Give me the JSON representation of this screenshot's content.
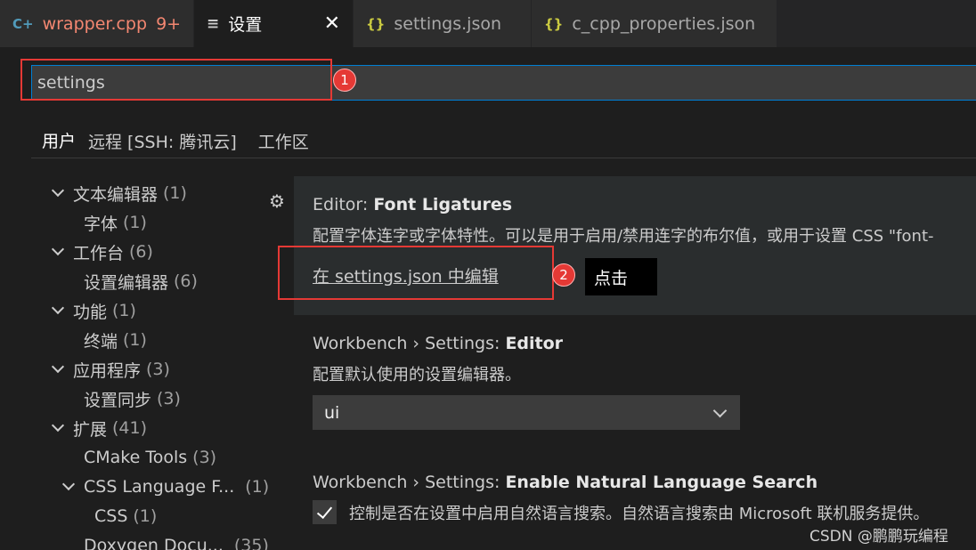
{
  "tabs": [
    {
      "icon": "C+",
      "label": "wrapper.cpp",
      "badge": "9+"
    },
    {
      "icon": "≡",
      "label": "设置",
      "close": "✕"
    },
    {
      "icon": "{}",
      "label": "settings.json"
    },
    {
      "icon": "{}",
      "label": "c_cpp_properties.json"
    }
  ],
  "search": {
    "value": "settings",
    "callout": "1"
  },
  "scopes": [
    "用户",
    "远程 [SSH: 腾讯云]",
    "工作区"
  ],
  "tree": [
    {
      "label": "文本编辑器",
      "count": "(1)"
    },
    {
      "label": "字体",
      "count": "(1)"
    },
    {
      "label": "工作台",
      "count": "(6)"
    },
    {
      "label": "设置编辑器",
      "count": "(6)"
    },
    {
      "label": "功能",
      "count": "(1)"
    },
    {
      "label": "终端",
      "count": "(1)"
    },
    {
      "label": "应用程序",
      "count": "(3)"
    },
    {
      "label": "设置同步",
      "count": "(3)"
    },
    {
      "label": "扩展",
      "count": "(41)"
    },
    {
      "label": "CMake Tools",
      "count": "(3)"
    },
    {
      "label": "CSS Language F...",
      "count": "(1)"
    },
    {
      "label": "CSS",
      "count": "(1)"
    },
    {
      "label": "Doxygen Docu...",
      "count": "(35)"
    }
  ],
  "settings": {
    "font_ligatures": {
      "prefix": "Editor: ",
      "name": "Font Ligatures",
      "desc": "配置字体连字或字体特性。可以是用于启用/禁用连字的布尔值，或用于设置 CSS \"font-",
      "edit_link": "在 settings.json 中编辑",
      "callout": "2",
      "tooltip": "点击"
    },
    "editor": {
      "prefix": "Workbench › Settings: ",
      "name": "Editor",
      "desc": "配置默认使用的设置编辑器。",
      "value": "ui"
    },
    "nls": {
      "prefix": "Workbench › Settings: ",
      "name": "Enable Natural Language Search",
      "desc": "控制是否在设置中启用自然语言搜索。自然语言搜索由 Microsoft 联机服务提供。",
      "checked": true
    }
  },
  "watermark": "CSDN @鹏鹏玩编程",
  "colors": {
    "accent": "#007fd4",
    "annotation": "#e53935",
    "error_tab": "#f48771"
  }
}
